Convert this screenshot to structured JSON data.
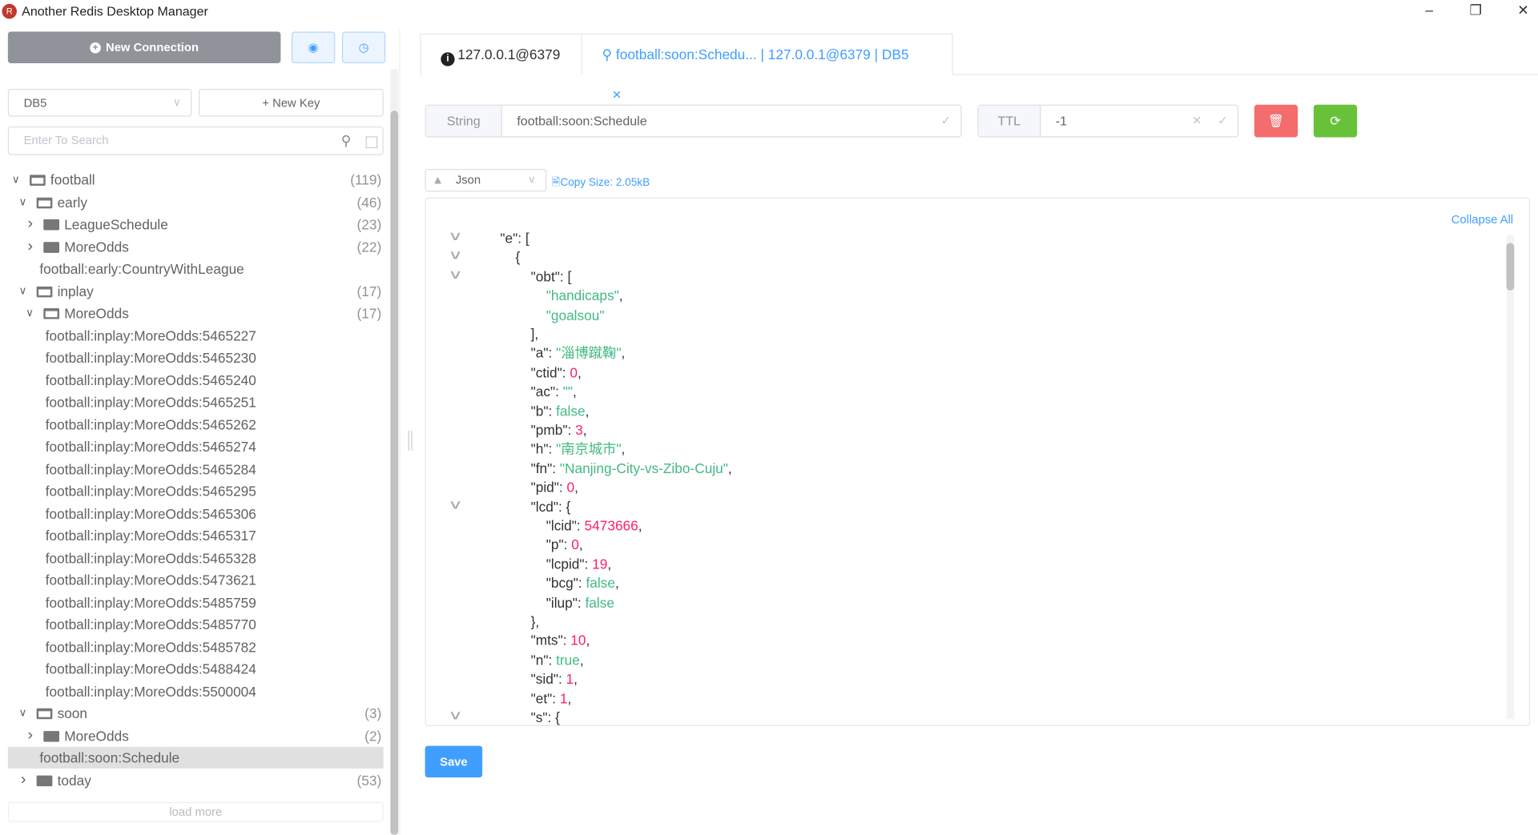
{
  "app": {
    "title": "Another Redis Desktop Manager",
    "window_controls": [
      "minimize",
      "restore",
      "close"
    ]
  },
  "sidebar": {
    "new_connection_label": "New Connection",
    "icon_buttons": [
      "settings-icon",
      "clock-icon"
    ],
    "db_select": "DB5",
    "new_key_label": "New Key",
    "search_placeholder": "Enter To Search",
    "load_more": "load more",
    "tree": [
      {
        "level": 0,
        "arrow": "open",
        "folder": "open",
        "label": "football",
        "count": "(119)"
      },
      {
        "level": 1,
        "arrow": "open",
        "folder": "open",
        "label": "early",
        "count": "(46)"
      },
      {
        "level": 2,
        "arrow": "closed",
        "folder": "closed",
        "label": "LeagueSchedule",
        "count": "(23)"
      },
      {
        "level": 2,
        "arrow": "closed",
        "folder": "closed",
        "label": "MoreOdds",
        "count": "(22)"
      },
      {
        "level": 1,
        "arrow": "none",
        "folder": "none",
        "label": "football:early:CountryWithLeague",
        "count": ""
      },
      {
        "level": 1,
        "arrow": "open",
        "folder": "open",
        "label": "inplay",
        "count": "(17)"
      },
      {
        "level": 2,
        "arrow": "open",
        "folder": "open",
        "label": "MoreOdds",
        "count": "(17)"
      },
      {
        "level": 2,
        "arrow": "none",
        "folder": "none",
        "label": "football:inplay:MoreOdds:5465227",
        "count": ""
      },
      {
        "level": 2,
        "arrow": "none",
        "folder": "none",
        "label": "football:inplay:MoreOdds:5465230",
        "count": ""
      },
      {
        "level": 2,
        "arrow": "none",
        "folder": "none",
        "label": "football:inplay:MoreOdds:5465240",
        "count": ""
      },
      {
        "level": 2,
        "arrow": "none",
        "folder": "none",
        "label": "football:inplay:MoreOdds:5465251",
        "count": ""
      },
      {
        "level": 2,
        "arrow": "none",
        "folder": "none",
        "label": "football:inplay:MoreOdds:5465262",
        "count": ""
      },
      {
        "level": 2,
        "arrow": "none",
        "folder": "none",
        "label": "football:inplay:MoreOdds:5465274",
        "count": ""
      },
      {
        "level": 2,
        "arrow": "none",
        "folder": "none",
        "label": "football:inplay:MoreOdds:5465284",
        "count": ""
      },
      {
        "level": 2,
        "arrow": "none",
        "folder": "none",
        "label": "football:inplay:MoreOdds:5465295",
        "count": ""
      },
      {
        "level": 2,
        "arrow": "none",
        "folder": "none",
        "label": "football:inplay:MoreOdds:5465306",
        "count": ""
      },
      {
        "level": 2,
        "arrow": "none",
        "folder": "none",
        "label": "football:inplay:MoreOdds:5465317",
        "count": ""
      },
      {
        "level": 2,
        "arrow": "none",
        "folder": "none",
        "label": "football:inplay:MoreOdds:5465328",
        "count": ""
      },
      {
        "level": 2,
        "arrow": "none",
        "folder": "none",
        "label": "football:inplay:MoreOdds:5473621",
        "count": ""
      },
      {
        "level": 2,
        "arrow": "none",
        "folder": "none",
        "label": "football:inplay:MoreOdds:5485759",
        "count": ""
      },
      {
        "level": 2,
        "arrow": "none",
        "folder": "none",
        "label": "football:inplay:MoreOdds:5485770",
        "count": ""
      },
      {
        "level": 2,
        "arrow": "none",
        "folder": "none",
        "label": "football:inplay:MoreOdds:5485782",
        "count": ""
      },
      {
        "level": 2,
        "arrow": "none",
        "folder": "none",
        "label": "football:inplay:MoreOdds:5488424",
        "count": ""
      },
      {
        "level": 2,
        "arrow": "none",
        "folder": "none",
        "label": "football:inplay:MoreOdds:5500004",
        "count": ""
      },
      {
        "level": 1,
        "arrow": "open",
        "folder": "open",
        "label": "soon",
        "count": "(3)"
      },
      {
        "level": 2,
        "arrow": "closed",
        "folder": "closed",
        "label": "MoreOdds",
        "count": "(2)"
      },
      {
        "level": 1,
        "arrow": "none",
        "folder": "none",
        "label": "football:soon:Schedule",
        "count": "",
        "selected": true
      },
      {
        "level": 1,
        "arrow": "closed",
        "folder": "closed",
        "label": "today",
        "count": "(53)"
      }
    ]
  },
  "tabs": [
    {
      "label": "127.0.0.1@6379",
      "icon": "info-icon"
    },
    {
      "label": "football:soon:Schedu... | 127.0.0.1@6379 | DB5",
      "icon": "key-icon",
      "active": true
    }
  ],
  "key": {
    "type": "String",
    "name": "football:soon:Schedule",
    "ttl_label": "TTL",
    "ttl": "-1"
  },
  "viewer": {
    "format": "Json",
    "copy_label": "Copy",
    "size": "Size: 2.05kB",
    "collapse_all": "Collapse All",
    "save_label": "Save"
  },
  "colors": {
    "primary": "#409eff",
    "danger": "#f56c6c",
    "success": "#67c23a",
    "string": "#42b983",
    "number": "#fc1e70"
  },
  "json_lines": [
    {
      "i": 0,
      "fold": true,
      "k": "\"e\": ",
      "v": "[",
      "t": ""
    },
    {
      "i": 1,
      "fold": true,
      "k": "",
      "v": "{",
      "t": ""
    },
    {
      "i": 2,
      "fold": true,
      "k": "\"obt\": ",
      "v": "[",
      "t": ""
    },
    {
      "i": 3,
      "k": "",
      "v": "\"handicaps\"",
      "t": "str",
      "s": ","
    },
    {
      "i": 3,
      "k": "",
      "v": "\"goalsou\"",
      "t": "str"
    },
    {
      "i": 2,
      "k": "",
      "v": "],",
      "t": ""
    },
    {
      "i": 2,
      "k": "\"a\": ",
      "v": "\"淄博蹴鞠\"",
      "t": "str",
      "s": ","
    },
    {
      "i": 2,
      "k": "\"ctid\": ",
      "v": "0",
      "t": "num",
      "s": ","
    },
    {
      "i": 2,
      "k": "\"ac\": ",
      "v": "\"\"",
      "t": "str",
      "s": ","
    },
    {
      "i": 2,
      "k": "\"b\": ",
      "v": "false",
      "t": "bool",
      "s": ","
    },
    {
      "i": 2,
      "k": "\"pmb\": ",
      "v": "3",
      "t": "num",
      "s": ","
    },
    {
      "i": 2,
      "k": "\"h\": ",
      "v": "\"南京城市\"",
      "t": "str",
      "s": ","
    },
    {
      "i": 2,
      "k": "\"fn\": ",
      "v": "\"Nanjing-City-vs-Zibo-Cuju\"",
      "t": "str",
      "s": ","
    },
    {
      "i": 2,
      "k": "\"pid\": ",
      "v": "0",
      "t": "num",
      "s": ","
    },
    {
      "i": 2,
      "fold": true,
      "k": "\"lcd\": ",
      "v": "{",
      "t": ""
    },
    {
      "i": 3,
      "k": "\"lcid\": ",
      "v": "5473666",
      "t": "num",
      "s": ","
    },
    {
      "i": 3,
      "k": "\"p\": ",
      "v": "0",
      "t": "num",
      "s": ","
    },
    {
      "i": 3,
      "k": "\"lcpid\": ",
      "v": "19",
      "t": "num",
      "s": ","
    },
    {
      "i": 3,
      "k": "\"bcg\": ",
      "v": "false",
      "t": "bool",
      "s": ","
    },
    {
      "i": 3,
      "k": "\"ilup\": ",
      "v": "false",
      "t": "bool"
    },
    {
      "i": 2,
      "k": "",
      "v": "},",
      "t": ""
    },
    {
      "i": 2,
      "k": "\"mts\": ",
      "v": "10",
      "t": "num",
      "s": ","
    },
    {
      "i": 2,
      "k": "\"n\": ",
      "v": "true",
      "t": "bool",
      "s": ","
    },
    {
      "i": 2,
      "k": "\"sid\": ",
      "v": "1",
      "t": "num",
      "s": ","
    },
    {
      "i": 2,
      "k": "\"et\": ",
      "v": "1",
      "t": "num",
      "s": ","
    },
    {
      "i": 2,
      "fold": true,
      "k": "\"s\": ",
      "v": "{",
      "t": ""
    }
  ]
}
